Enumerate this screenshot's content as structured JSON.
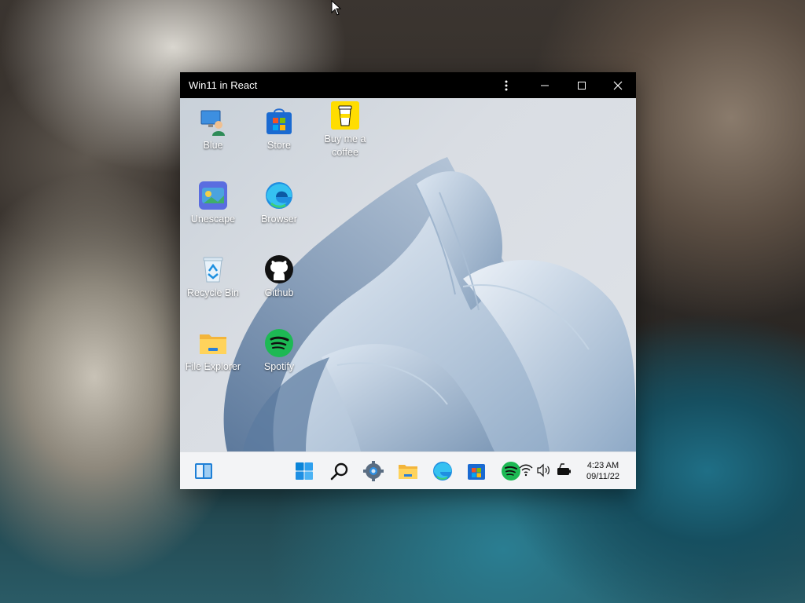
{
  "window": {
    "title": "Win11 in React"
  },
  "desktop_icons": [
    {
      "label": "Blue",
      "icon": "blue-user-icon"
    },
    {
      "label": "Store",
      "icon": "store-icon"
    },
    {
      "label": "Buy me a coffee",
      "icon": "coffee-icon"
    },
    {
      "label": "Unescape",
      "icon": "unescape-icon"
    },
    {
      "label": "Browser",
      "icon": "edge-browser-icon"
    },
    {
      "label": "Recycle Bin",
      "icon": "recycle-bin-icon"
    },
    {
      "label": "Github",
      "icon": "github-icon"
    },
    {
      "label": "File Explorer",
      "icon": "folder-icon"
    },
    {
      "label": "Spotify",
      "icon": "spotify-icon"
    }
  ],
  "taskbar": {
    "time": "4:23 AM",
    "date": "09/11/22",
    "items": [
      "widgets-icon",
      "start-icon",
      "search-icon",
      "settings-icon",
      "file-explorer-icon",
      "edge-icon",
      "store-icon",
      "spotify-icon"
    ],
    "tray": [
      "wifi-icon",
      "volume-icon",
      "battery-icon"
    ]
  },
  "colors": {
    "titlebar": "#000000",
    "taskbar": "#f3f4f6",
    "accent": "#0a84d8",
    "spotify": "#1db954"
  }
}
